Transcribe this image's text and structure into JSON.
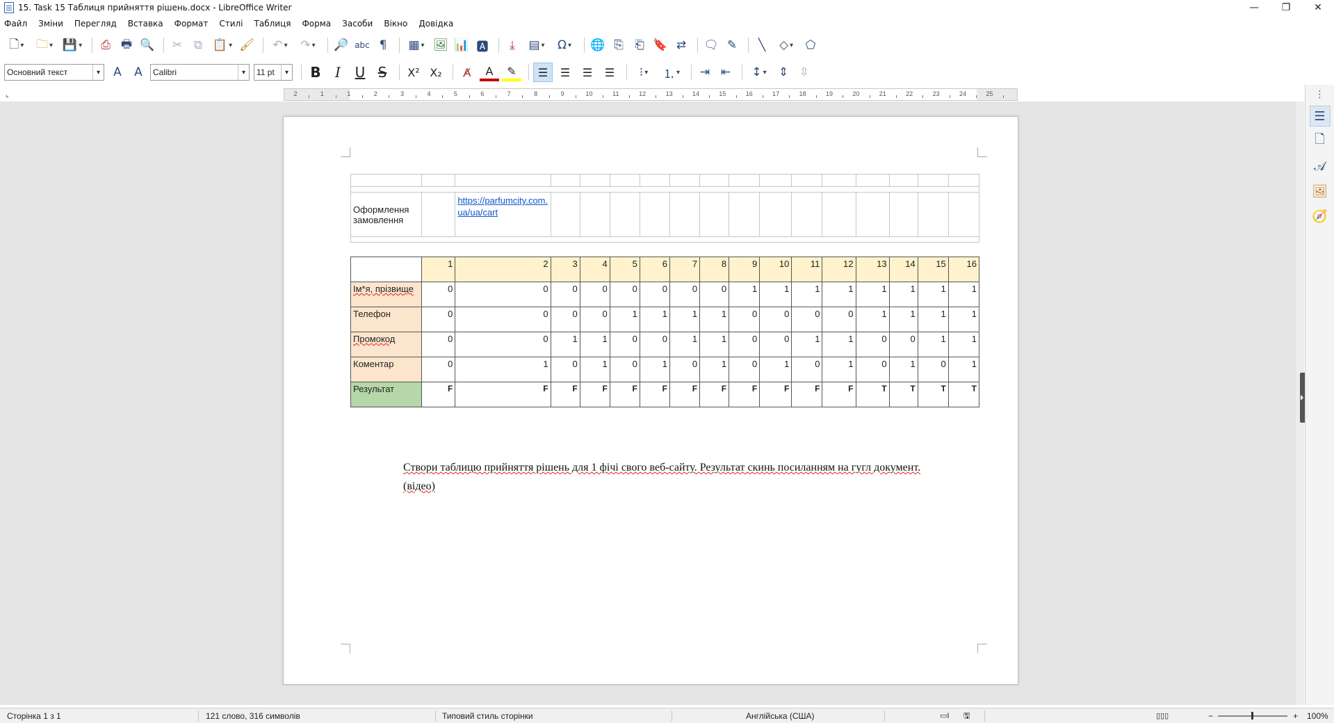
{
  "window": {
    "title": "15. Task 15 Таблиця прийняття рішень.docx - LibreOffice Writer",
    "minimize": "—",
    "restore": "❐",
    "close": "✕"
  },
  "menu": [
    "Файл",
    "Зміни",
    "Перегляд",
    "Вставка",
    "Формат",
    "Стилі",
    "Таблиця",
    "Форма",
    "Засоби",
    "Вікно",
    "Довідка"
  ],
  "formatting": {
    "paragraph_style": "Основний текст",
    "font_name": "Calibri",
    "font_size": "11 pt"
  },
  "ruler": {
    "labels": [
      "2",
      "1",
      "1",
      "2",
      "3",
      "4",
      "5",
      "6",
      "7",
      "8",
      "9",
      "10",
      "11",
      "12",
      "13",
      "14",
      "15",
      "16",
      "17",
      "18",
      "19",
      "20",
      "21",
      "22",
      "23",
      "24",
      "25"
    ]
  },
  "document": {
    "top_table": {
      "row_label": "Оформлення замовлення",
      "link_text": "https://parfumcity.com.ua/ua/cart"
    },
    "decision_table": {
      "column_numbers": [
        "1",
        "2",
        "3",
        "4",
        "5",
        "6",
        "7",
        "8",
        "9",
        "10",
        "11",
        "12",
        "13",
        "14",
        "15",
        "16"
      ],
      "rows": [
        {
          "label": "Ім*я, прізвище",
          "values": [
            "0",
            "0",
            "0",
            "0",
            "0",
            "0",
            "0",
            "0",
            "1",
            "1",
            "1",
            "1",
            "1",
            "1",
            "1",
            "1"
          ]
        },
        {
          "label": "Телефон",
          "values": [
            "0",
            "0",
            "0",
            "0",
            "1",
            "1",
            "1",
            "1",
            "0",
            "0",
            "0",
            "0",
            "1",
            "1",
            "1",
            "1"
          ]
        },
        {
          "label": "Промокод",
          "values": [
            "0",
            "0",
            "1",
            "1",
            "0",
            "0",
            "1",
            "1",
            "0",
            "0",
            "1",
            "1",
            "0",
            "0",
            "1",
            "1"
          ]
        },
        {
          "label": "Коментар",
          "values": [
            "0",
            "1",
            "0",
            "1",
            "0",
            "1",
            "0",
            "1",
            "0",
            "1",
            "0",
            "1",
            "0",
            "1",
            "0",
            "1"
          ]
        }
      ],
      "result": {
        "label": "Результат",
        "values": [
          "F",
          "F",
          "F",
          "F",
          "F",
          "F",
          "F",
          "F",
          "F",
          "F",
          "F",
          "F",
          "T",
          "T",
          "T",
          "T"
        ]
      }
    },
    "task_text": "Створи таблицю прийняття рішень для 1 фічі свого веб-сайту. Результат скинь посиланням на гугл документ.",
    "task_link": "(відео)"
  },
  "status": {
    "page": "Сторінка 1 з 1",
    "words": "121 слово, 316 символів",
    "page_style": "Типовий стиль сторінки",
    "language": "Англійська (США)",
    "zoom": "100%"
  },
  "colors": {
    "header_fill": "#fff2cc",
    "label_fill": "#fce5cd",
    "result_fill": "#b6d7a8",
    "link": "#1155cc"
  }
}
